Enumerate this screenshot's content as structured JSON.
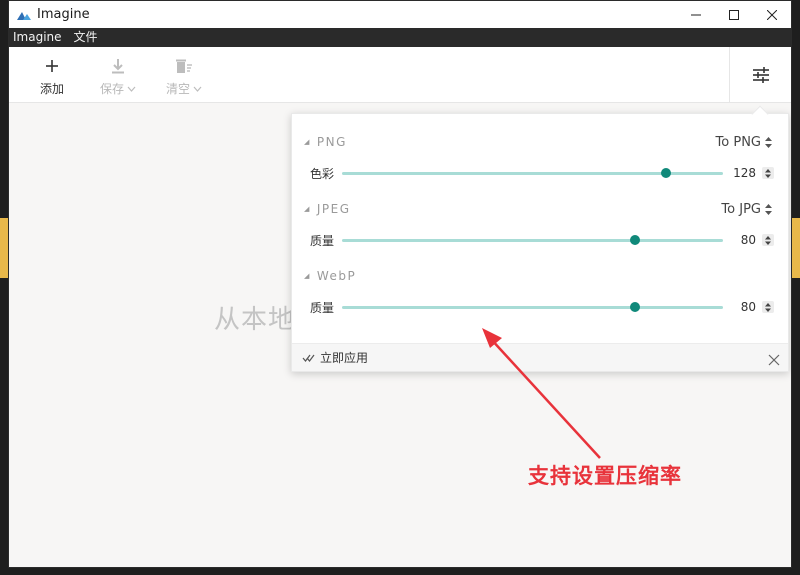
{
  "window": {
    "title": "Imagine"
  },
  "menu": [
    "Imagine",
    "文件"
  ],
  "toolbar": {
    "add_label": "添加",
    "save_label": "保存",
    "clear_label": "清空"
  },
  "main": {
    "drop_hint": "从本地"
  },
  "panel": {
    "png": {
      "title": "PNG",
      "target": "To PNG",
      "row_label": "色彩",
      "value": "128",
      "fraction": 0.85
    },
    "jpeg": {
      "title": "JPEG",
      "target": "To JPG",
      "row_label": "质量",
      "value": "80",
      "fraction": 0.77
    },
    "webp": {
      "title": "WebP",
      "row_label": "质量",
      "value": "80",
      "fraction": 0.77
    },
    "apply_label": "立即应用"
  },
  "annotation": {
    "text": "支持设置压缩率",
    "color": "#e8333b"
  },
  "colors": {
    "accent": "#10897a",
    "track": "#a8dcd6"
  }
}
